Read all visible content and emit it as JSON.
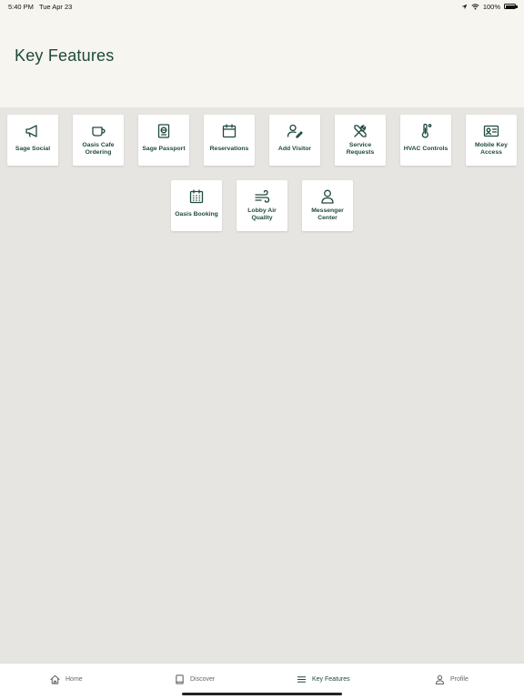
{
  "status": {
    "time": "5:40 PM",
    "date": "Tue Apr 23",
    "battery": "100%"
  },
  "header": {
    "title": "Key Features"
  },
  "features": {
    "sage_social": "Sage Social",
    "oasis_cafe": "Oasis Cafe Ordering",
    "sage_passport": "Sage Passport",
    "reservations": "Reservations",
    "add_visitor": "Add Visitor",
    "service_requests": "Service Requests",
    "hvac_controls": "HVAC Controls",
    "mobile_key": "Mobile Key Access",
    "oasis_booking": "Oasis Booking",
    "lobby_air": "Lobby Air Quality",
    "messenger_center": "Messenger Center"
  },
  "icons": {
    "sage_social": "megaphone-icon",
    "oasis_cafe": "coffee-cup-icon",
    "sage_passport": "passport-icon",
    "reservations": "calendar-icon",
    "add_visitor": "user-edit-icon",
    "service_requests": "tools-icon",
    "hvac_controls": "thermometer-icon",
    "mobile_key": "id-card-icon",
    "oasis_booking": "calendar-grid-icon",
    "lobby_air": "wind-icon",
    "messenger_center": "person-icon"
  },
  "tabs": {
    "home": "Home",
    "discover": "Discover",
    "key_features": "Key Features",
    "profile": "Profile"
  },
  "colors": {
    "accent": "#1f4a3c",
    "header_bg": "#f7f5ef",
    "page_bg": "#e6e5e1"
  }
}
